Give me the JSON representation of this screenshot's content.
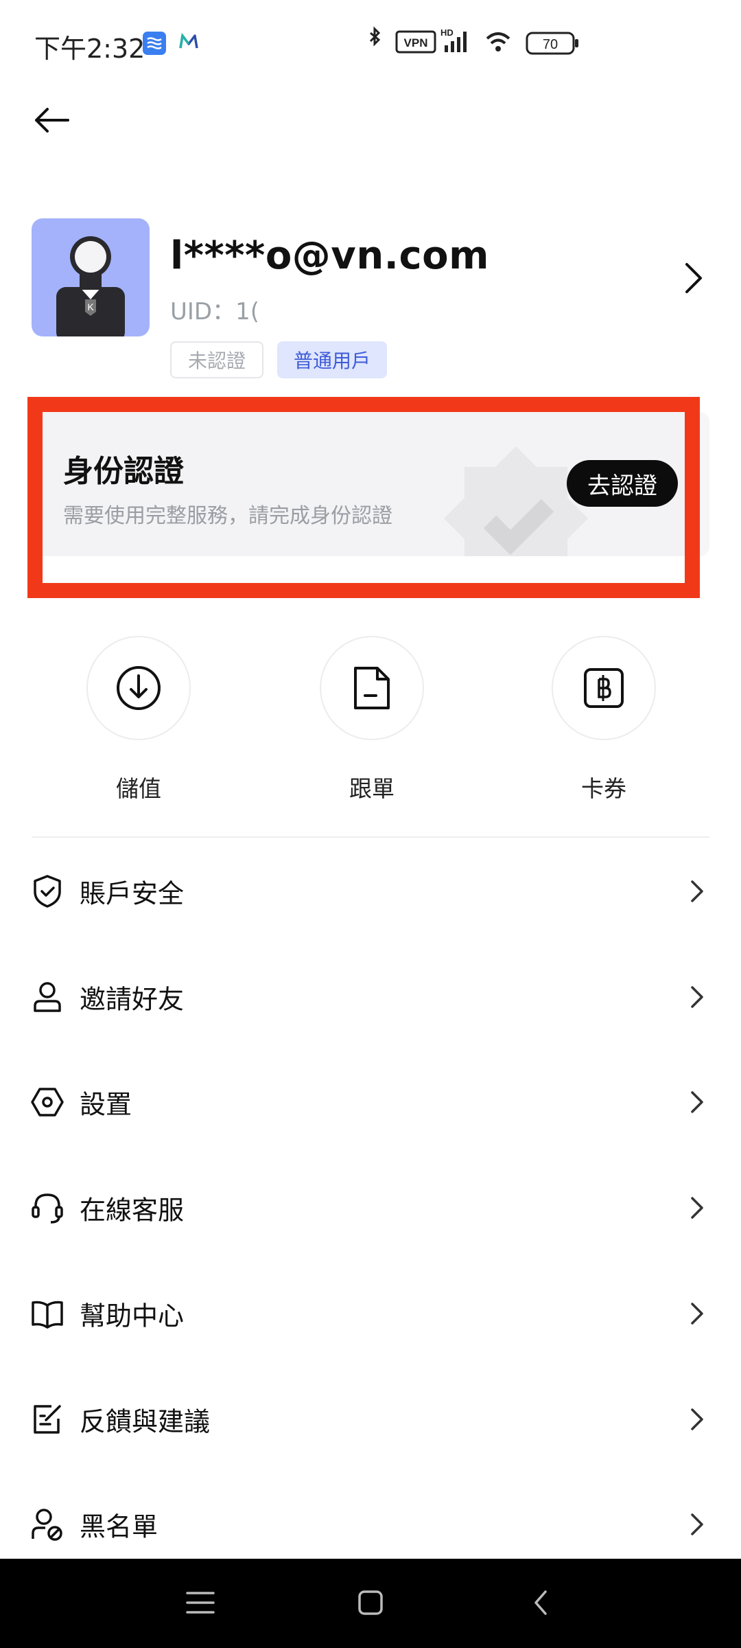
{
  "status_bar": {
    "time": "下午2:32",
    "vpn": "VPN",
    "network": "HD",
    "battery": "70"
  },
  "profile": {
    "email": "l****o@vn.com",
    "uid": "UID：1(",
    "avatar_letter": "K",
    "badges": [
      "未認證",
      "普通用戶"
    ]
  },
  "verification": {
    "title": "身份認證",
    "subtitle": "需要使用完整服務，請完成身份認證",
    "button": "去認證"
  },
  "quick_actions": [
    {
      "label": "儲值",
      "icon": "download-circle-icon"
    },
    {
      "label": "跟單",
      "icon": "document-icon"
    },
    {
      "label": "卡券",
      "icon": "baht-coupon-icon"
    }
  ],
  "menu": [
    {
      "label": "賬戶安全",
      "icon": "shield-check-icon"
    },
    {
      "label": "邀請好友",
      "icon": "user-icon"
    },
    {
      "label": "設置",
      "icon": "hexagon-settings-icon"
    },
    {
      "label": "在線客服",
      "icon": "headset-icon"
    },
    {
      "label": "幫助中心",
      "icon": "book-icon"
    },
    {
      "label": "反饋與建議",
      "icon": "feedback-edit-icon"
    },
    {
      "label": "黑名單",
      "icon": "user-blocked-icon"
    }
  ],
  "colors": {
    "highlight_border": "#f1391a",
    "badge_normal_bg": "#dfe6fd",
    "badge_normal_text": "#3f5bd8",
    "avatar_bg": "#a4b2fb",
    "button_bg": "#0c0c0c"
  }
}
